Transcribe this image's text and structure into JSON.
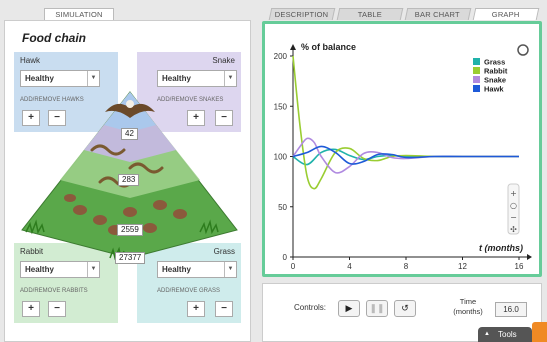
{
  "tabs": {
    "simulation": "SIMULATION",
    "description": "DESCRIPTION",
    "table": "TABLE",
    "bar_chart": "BAR CHART",
    "graph": "GRAPH"
  },
  "title": "Food chain",
  "hawk": {
    "name": "Hawk",
    "status": "Healthy",
    "label": "ADD/REMOVE HAWKS",
    "count": "42"
  },
  "snake": {
    "name": "Snake",
    "status": "Healthy",
    "label": "ADD/REMOVE SNAKES",
    "count": "283"
  },
  "rabbit": {
    "name": "Rabbit",
    "status": "Healthy",
    "label": "ADD/REMOVE RABBITS",
    "count": "2559"
  },
  "grass": {
    "name": "Grass",
    "status": "Healthy",
    "label": "ADD/REMOVE GRASS",
    "count": "27377"
  },
  "buttons": {
    "plus": "+",
    "minus": "−",
    "play": "▶",
    "pause": "❚❚",
    "reset": "↺"
  },
  "controls": {
    "label": "Controls:",
    "time_label_1": "Time",
    "time_label_2": "(months)",
    "time_value": "16.0",
    "tools": "Tools"
  },
  "colors": {
    "grass": "#20b2aa",
    "rabbit": "#9acd32",
    "snake": "#b08ae0",
    "hawk": "#1e5ad8"
  },
  "chart_data": {
    "type": "line",
    "ylabel": "% of balance",
    "xlabel": "t (months)",
    "xlim": [
      0,
      16
    ],
    "ylim": [
      0,
      200
    ],
    "xticks": [
      0,
      4,
      8,
      12,
      16
    ],
    "yticks": [
      0,
      50,
      100,
      150,
      200
    ],
    "grid": false,
    "legend": "top-right",
    "series": [
      {
        "name": "Grass",
        "values": [
          [
            0,
            100
          ],
          [
            1,
            92
          ],
          [
            2,
            104
          ],
          [
            3,
            107
          ],
          [
            4,
            101
          ],
          [
            5,
            97
          ],
          [
            6,
            100
          ],
          [
            7,
            101
          ],
          [
            8,
            100
          ],
          [
            10,
            100
          ],
          [
            12,
            100
          ],
          [
            16,
            100
          ]
        ]
      },
      {
        "name": "Rabbit",
        "values": [
          [
            0,
            200
          ],
          [
            0.5,
            130
          ],
          [
            1,
            80
          ],
          [
            1.5,
            68
          ],
          [
            2,
            78
          ],
          [
            3,
            104
          ],
          [
            4,
            108
          ],
          [
            5,
            98
          ],
          [
            6,
            96
          ],
          [
            7,
            100
          ],
          [
            8,
            101
          ],
          [
            10,
            100
          ],
          [
            12,
            100
          ],
          [
            16,
            100
          ]
        ]
      },
      {
        "name": "Snake",
        "values": [
          [
            0,
            100
          ],
          [
            0.5,
            110
          ],
          [
            1,
            118
          ],
          [
            1.5,
            114
          ],
          [
            2,
            100
          ],
          [
            3,
            84
          ],
          [
            4,
            90
          ],
          [
            5,
            103
          ],
          [
            6,
            104
          ],
          [
            7,
            99
          ],
          [
            8,
            98
          ],
          [
            10,
            100
          ],
          [
            12,
            100
          ],
          [
            16,
            100
          ]
        ]
      },
      {
        "name": "Hawk",
        "values": [
          [
            0,
            100
          ],
          [
            1,
            104
          ],
          [
            2,
            110
          ],
          [
            3,
            104
          ],
          [
            4,
            93
          ],
          [
            5,
            95
          ],
          [
            6,
            102
          ],
          [
            7,
            102
          ],
          [
            8,
            99
          ],
          [
            10,
            100
          ],
          [
            12,
            100
          ],
          [
            16,
            100
          ]
        ]
      }
    ]
  }
}
